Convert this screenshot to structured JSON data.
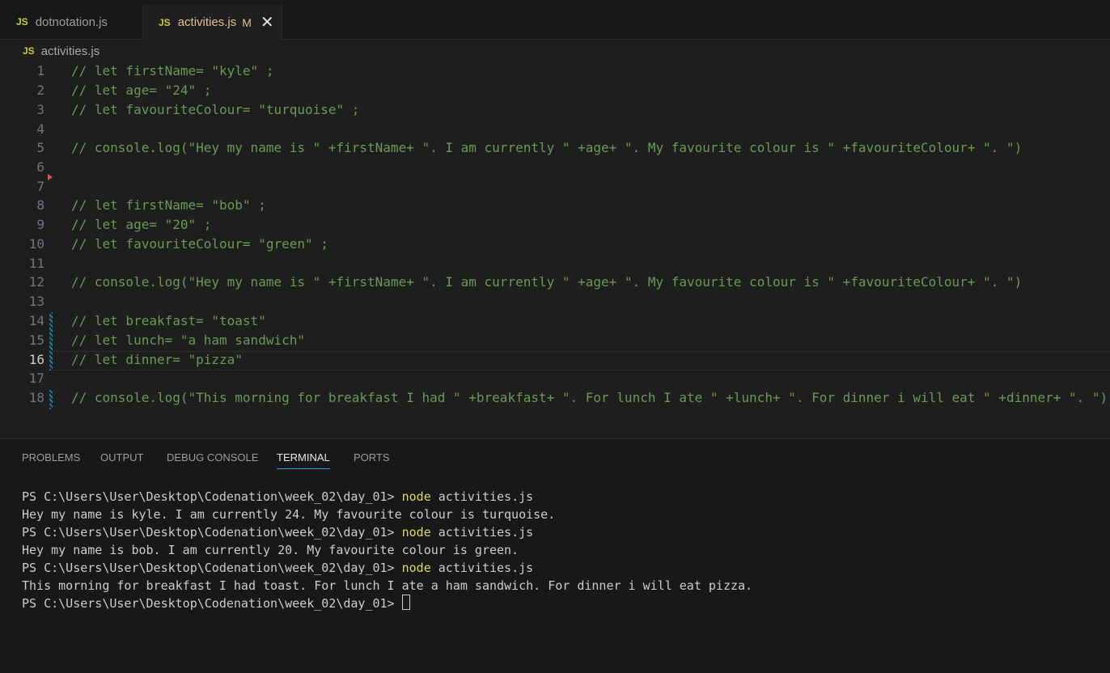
{
  "tabs": [
    {
      "icon": "JS",
      "label": "dotnotation.js"
    },
    {
      "icon": "JS",
      "label": "activities.js",
      "modified": "M"
    }
  ],
  "breadcrumb": {
    "icon": "JS",
    "file": "activities.js"
  },
  "editor": {
    "active_line": 16,
    "lines": [
      {
        "n": "1",
        "text": "// let firstName= \"kyle\" ;"
      },
      {
        "n": "2",
        "text": "// let age= \"24\" ;"
      },
      {
        "n": "3",
        "text": "// let favouriteColour= \"turquoise\" ;"
      },
      {
        "n": "4",
        "text": ""
      },
      {
        "n": "5",
        "text": "// console.log(\"Hey my name is \" +firstName+ \". I am currently \" +age+ \". My favourite colour is \" +favouriteColour+ \". \")"
      },
      {
        "n": "6",
        "text": ""
      },
      {
        "n": "7",
        "text": ""
      },
      {
        "n": "8",
        "text": "// let firstName= \"bob\" ;"
      },
      {
        "n": "9",
        "text": "// let age= \"20\" ;"
      },
      {
        "n": "10",
        "text": "// let favouriteColour= \"green\" ;"
      },
      {
        "n": "11",
        "text": ""
      },
      {
        "n": "12",
        "text": "// console.log(\"Hey my name is \" +firstName+ \". I am currently \" +age+ \". My favourite colour is \" +favouriteColour+ \". \")"
      },
      {
        "n": "13",
        "text": ""
      },
      {
        "n": "14",
        "text": "// let breakfast= \"toast\""
      },
      {
        "n": "15",
        "text": "// let lunch= \"a ham sandwich\""
      },
      {
        "n": "16",
        "text": "// let dinner= \"pizza\""
      },
      {
        "n": "17",
        "text": ""
      },
      {
        "n": "18",
        "text": "// console.log(\"This morning for breakfast I had \" +breakfast+ \". For lunch I ate \" +lunch+ \". For dinner i will eat \" +dinner+ \". \")"
      }
    ]
  },
  "panel": {
    "tabs": [
      "PROBLEMS",
      "OUTPUT",
      "DEBUG CONSOLE",
      "TERMINAL",
      "PORTS"
    ],
    "active_tab": "TERMINAL"
  },
  "terminal": {
    "prompt": "PS C:\\Users\\User\\Desktop\\Codenation\\week_02\\day_01> ",
    "cmd": "node",
    "arg": " activities.js",
    "outputs": [
      "Hey my name is kyle. I am currently 24. My favourite colour is turquoise.",
      "Hey my name is bob. I am currently 20. My favourite colour is green.",
      "This morning for breakfast I had toast. For lunch I ate a ham sandwich. For dinner i will eat pizza."
    ]
  }
}
